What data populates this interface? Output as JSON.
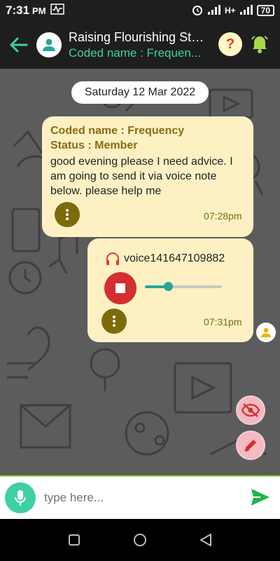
{
  "status_bar": {
    "time": "7:31",
    "ampm": "PM",
    "network": "H+",
    "battery": "70"
  },
  "header": {
    "title": "Raising Flourishing Stu...",
    "subtitle": "Coded name : Frequen...",
    "help_symbol": "?"
  },
  "chat": {
    "date": "Saturday 12 Mar 2022",
    "messages": [
      {
        "sender": "Coded name : Frequency",
        "status": "Status : Member",
        "text": "good evening please I need advice. I am going to send it via voice note below. please help me",
        "time": "07:28pm"
      },
      {
        "voice_name": "voice141647109882",
        "progress": 0.3,
        "time": "07:31pm"
      }
    ]
  },
  "composer": {
    "placeholder": "type here..."
  },
  "colors": {
    "accent": "#3fcfa4",
    "bubble": "#fdf1c4",
    "stop": "#d32f2f",
    "fab": "#f4b9c1"
  }
}
